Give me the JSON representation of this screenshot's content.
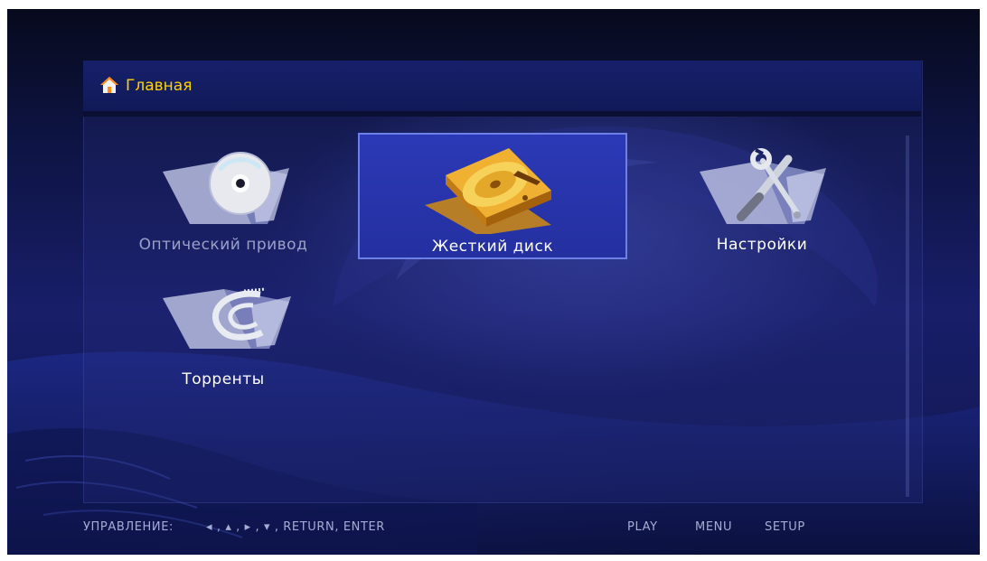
{
  "header": {
    "title": "Главная",
    "icon": "home-icon",
    "title_color": "#ffd200"
  },
  "tiles": [
    {
      "label": "Оптический привод",
      "icon": "optical-disc-icon",
      "selected": false,
      "dimmed": true
    },
    {
      "label": "Жесткий диск",
      "icon": "hard-disk-icon",
      "selected": true,
      "dimmed": false
    },
    {
      "label": "Настройки",
      "icon": "settings-tools-icon",
      "selected": false,
      "dimmed": false
    },
    {
      "label": "Торренты",
      "icon": "torrent-icon",
      "selected": false,
      "dimmed": false
    }
  ],
  "footer": {
    "controls_label": "УПРАВЛЕНИЕ:",
    "controls_keys": "◂ , ▴ , ▸ , ▾ , RETURN,  ENTER",
    "play": "PLAY",
    "menu": "MENU",
    "setup": "SETUP"
  },
  "colors": {
    "accent": "#ffd200",
    "selection": "#2b39b6",
    "background": "#181e68"
  }
}
